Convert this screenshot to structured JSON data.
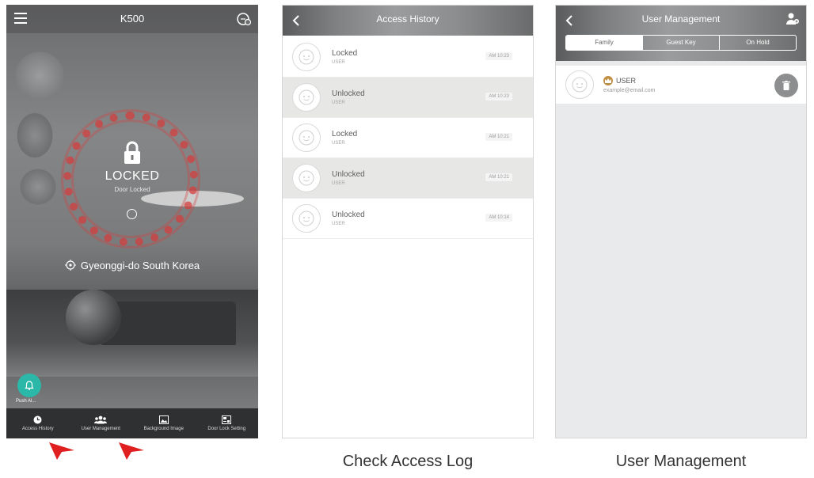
{
  "main_screen": {
    "title": "K500",
    "lock_state": "LOCKED",
    "lock_substate": "Door Locked",
    "location": "Gyeonggi-do  South Korea",
    "push_label": "Push Al...",
    "nav": [
      {
        "label": "Access  History",
        "icon": "clock-icon"
      },
      {
        "label": "User Management",
        "icon": "users-icon"
      },
      {
        "label": "Background Image",
        "icon": "image-icon"
      },
      {
        "label": "Door Lock Setting",
        "icon": "settings-panel-icon"
      }
    ],
    "ring_color": "#d63e3e",
    "push_color": "#2bb8a8",
    "arrow_color": "#e02020"
  },
  "access_history": {
    "title": "Access History",
    "entries": [
      {
        "status": "Locked",
        "user": "USER",
        "time": "AM 10:23"
      },
      {
        "status": "Unlocked",
        "user": "USER",
        "time": "AM 10:23"
      },
      {
        "status": "Locked",
        "user": "USER",
        "time": "AM 10:21"
      },
      {
        "status": "Unlocked",
        "user": "USER",
        "time": "AM 10:21"
      },
      {
        "status": "Unlocked",
        "user": "USER",
        "time": "AM 10:14"
      }
    ]
  },
  "user_management": {
    "title": "User Management",
    "tabs": [
      "Family",
      "Guest Key",
      "On Hold"
    ],
    "active_tab": "Family",
    "user": {
      "name": "USER",
      "email": "example@email.com"
    },
    "badge_color": "#c08e42"
  },
  "captions": {
    "access": "Check Access Log",
    "users": "User Management"
  }
}
